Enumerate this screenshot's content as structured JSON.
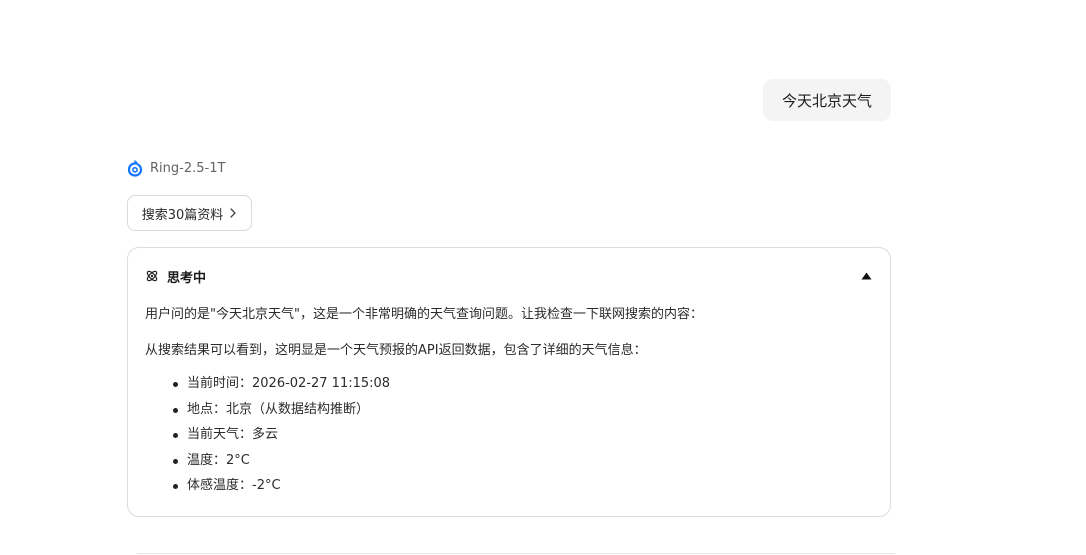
{
  "conversation": {
    "user_message": "今天北京天气",
    "assistant": {
      "model_name": "Ring-2.5-1T",
      "search_button_label": "搜索30篇资料",
      "thinking": {
        "title": "思考中",
        "paragraphs": [
          "用户问的是\"今天北京天气\"，这是一个非常明确的天气查询问题。让我检查一下联网搜索的内容：",
          "从搜索结果可以看到，这明显是一个天气预报的API返回数据，包含了详细的天气信息："
        ],
        "bullets": [
          "当前时间：2026-02-27 11:15:08",
          "地点：北京（从数据结构推断）",
          "当前天气：多云",
          "温度：2°C",
          "体感温度：-2°C"
        ]
      }
    }
  },
  "colors": {
    "logo_blue": "#1677ff",
    "user_bubble_bg": "#f4f4f5",
    "border": "#dcdce0"
  },
  "icons": {
    "model_logo": "ring-logo-icon",
    "search_chevron": "chevron-right-icon",
    "thinking": "atom-icon",
    "collapse": "triangle-up-icon"
  }
}
